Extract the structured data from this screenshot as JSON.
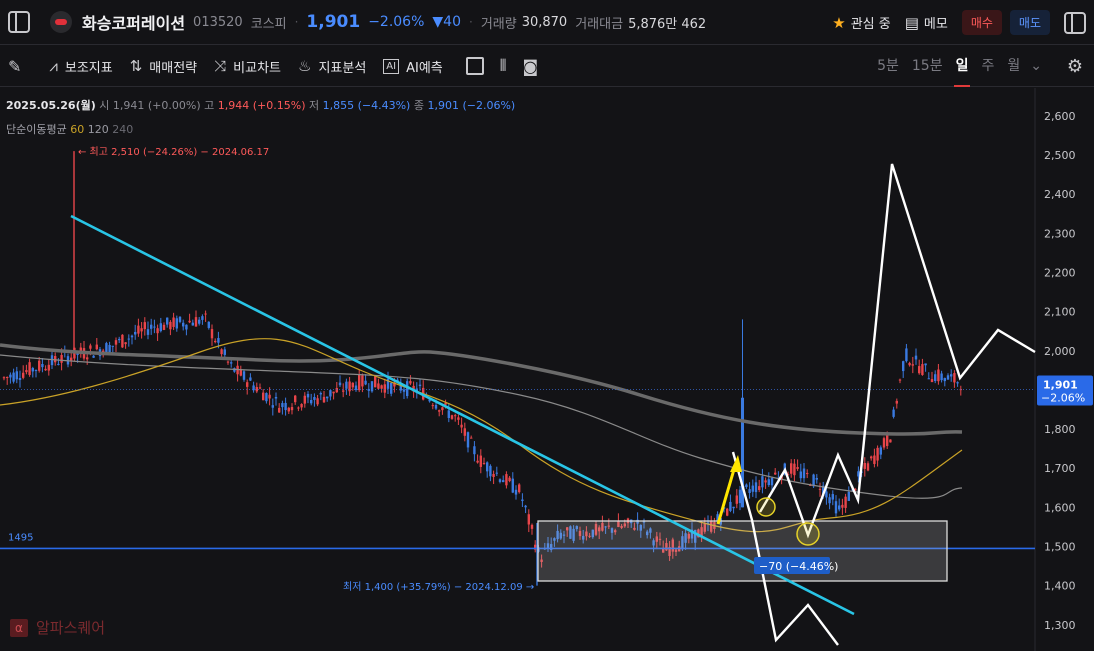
{
  "header": {
    "stock_name": "화승코퍼레이션",
    "stock_code": "013520",
    "market": "코스피",
    "price": "1,901",
    "change_pct": "−2.06%",
    "change_abs": "▼40",
    "volume_label": "거래량",
    "volume": "30,870",
    "amount_label": "거래대금",
    "amount": "5,876만 462",
    "watch_label": "관심 중",
    "memo_label": "메모",
    "buy_label": "매수",
    "sell_label": "매도"
  },
  "toolbar": {
    "items": [
      "보조지표",
      "매매전략",
      "비교차트",
      "지표분석",
      "AI예측"
    ],
    "timeframes": [
      "5분",
      "15분",
      "일",
      "주",
      "월"
    ],
    "active_timeframe": "일"
  },
  "info": {
    "date": "2025.05.26(월)",
    "open_label": "시",
    "open": "1,941 (+0.00%)",
    "high_label": "고",
    "high": "1,944 (+0.15%)",
    "low_label": "저",
    "low": "1,855 (−4.43%)",
    "close_label": "종",
    "close": "1,901 (−2.06%)",
    "ma_label": "단순이동평균",
    "ma_periods": [
      "60",
      "120",
      "240"
    ]
  },
  "annotations": {
    "high_note": "최고 2,510 (−24.26%) − 2024.06.17",
    "low_note": "최저 1,400 (+35.79%) − 2024.12.09",
    "level_label": "1495",
    "range_label": "−70 (−4.46%)",
    "price_tag": "1,901",
    "price_tag_pct": "−2.06%"
  },
  "brand": "알파스퀘어",
  "chart_data": {
    "type": "candlestick",
    "y_ticks": [
      "2,600",
      "2,500",
      "2,400",
      "2,300",
      "2,200",
      "2,100",
      "2,000",
      "1,900",
      "1,800",
      "1,700",
      "1,600",
      "1,500",
      "1,400",
      "1,300"
    ],
    "ylim": [
      1260,
      2640
    ],
    "high": 2510,
    "low": 1400,
    "last_close": 1901,
    "support_level": 1495,
    "colors": {
      "up": "#e8454a",
      "down": "#3a7ae0",
      "ma60": "#c9a227",
      "ma120": "#8a8a8a",
      "ma240": "#6a6a6a",
      "trendline": "#29c5e6",
      "projection": "#ffffff",
      "arrow": "#ffe600"
    }
  }
}
